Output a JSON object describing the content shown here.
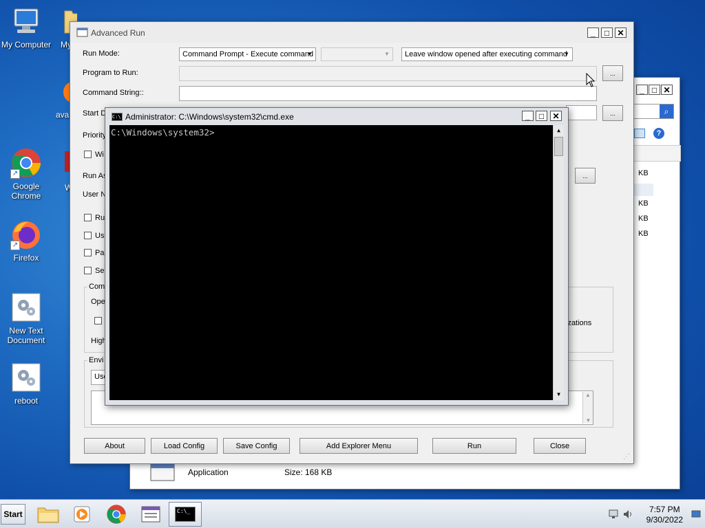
{
  "desktop": {
    "icons": [
      {
        "label": "My Computer"
      },
      {
        "label": "My"
      },
      {
        "label": "avas"
      },
      {
        "label": "Google Chrome"
      },
      {
        "label": "W"
      },
      {
        "label": "Firefox"
      },
      {
        "label": "New Text Document"
      },
      {
        "label": "reboot"
      }
    ]
  },
  "advanced_run": {
    "title": "Advanced Run",
    "labels": {
      "run_mode": "Run Mode:",
      "program_to_run": "Program to Run:",
      "command_string": "Command String::",
      "start_dir": "Start D",
      "priority": "Priority",
      "chk_wi": "Wi",
      "run_as": "Run As",
      "user_name": "User N",
      "chk_ru": "Ru",
      "chk_us": "Us",
      "chk_pa": "Pa",
      "chk_se": "Se",
      "group_com": "Com",
      "ope": "Ope",
      "high": "High",
      "izations": "izations",
      "group_envi": "Envi",
      "use": "Use"
    },
    "run_mode_value": "Command Prompt - Execute command",
    "after_exec_value": "Leave window opened after executing command",
    "browse_label": "...",
    "buttons": {
      "about": "About",
      "load_config": "Load Config",
      "save_config": "Save Config",
      "add_explorer_menu": "Add Explorer Menu",
      "run": "Run",
      "close": "Close"
    }
  },
  "explorer_window": {
    "sizes": [
      "KB",
      "KB",
      "KB",
      "KB"
    ],
    "file_name": "Application",
    "file_size": "Size: 168 KB"
  },
  "cmd": {
    "title": "Administrator: C:\\Windows\\system32\\cmd.exe",
    "prompt": "C:\\Windows\\system32>"
  },
  "window_controls": {
    "minimize": "_",
    "maximize": "□",
    "close": "✕"
  },
  "taskbar": {
    "start_label": "Start",
    "time": "7:57 PM",
    "date": "9/30/2022"
  },
  "colors": {
    "desktop": "#1f6dc4",
    "console_bg": "#000000",
    "console_text": "#c8c8c8"
  }
}
